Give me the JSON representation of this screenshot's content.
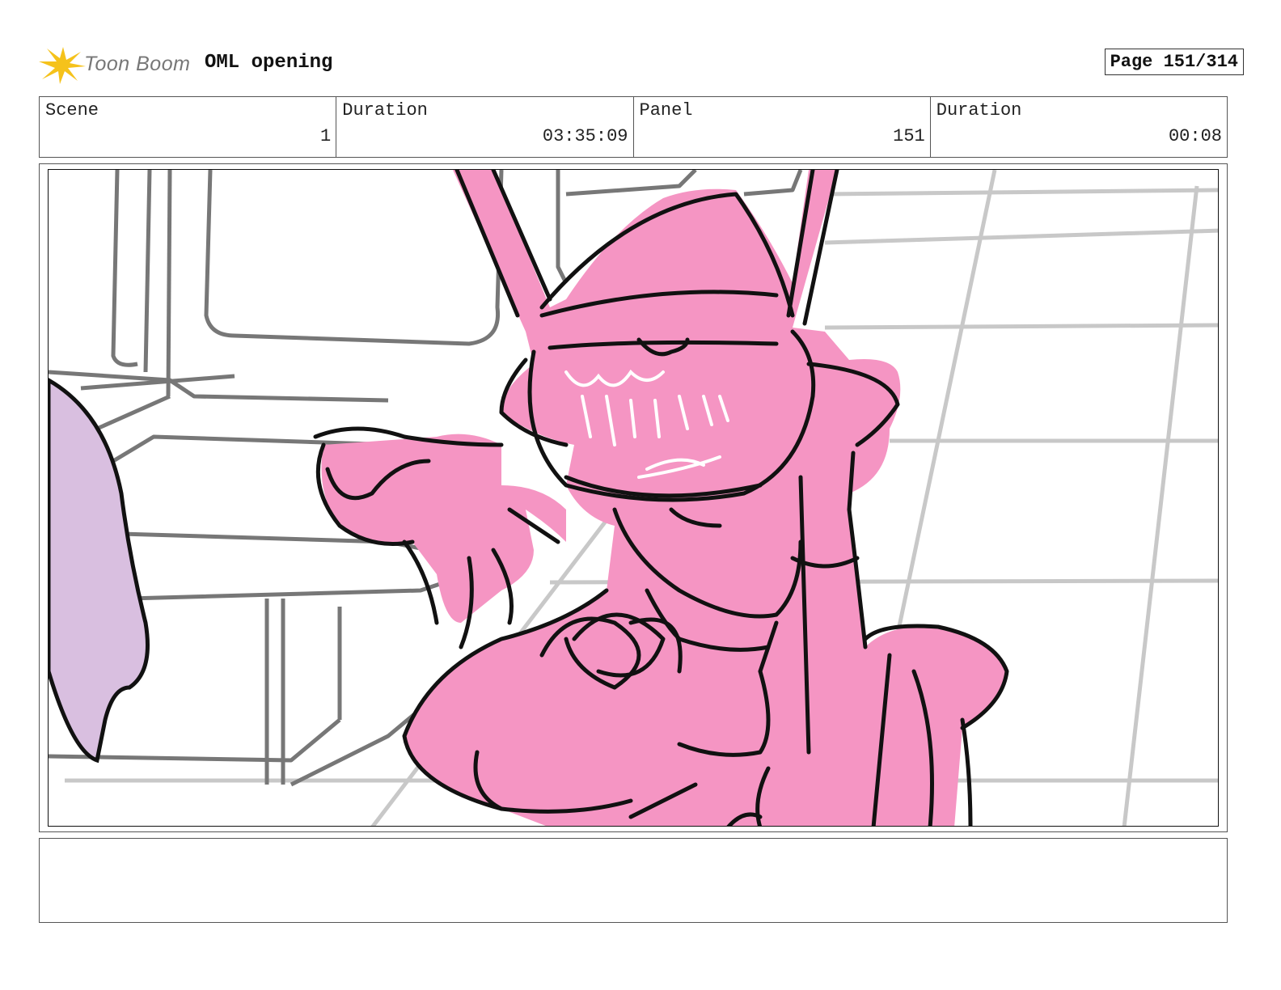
{
  "header": {
    "brand": "Toon Boom",
    "project_title": "OML opening",
    "page_label": "Page 151/314"
  },
  "info": {
    "scene_label": "Scene",
    "scene_value": "1",
    "duration_label": "Duration",
    "duration_value": "03:35:09",
    "panel_label": "Panel",
    "panel_value": "151",
    "panel_duration_label": "Duration",
    "panel_duration_value": "00:08"
  },
  "colors": {
    "character_fill": "#f595c3",
    "side_character_fill": "#d9bfe0",
    "background_line": "#777777",
    "floor_grid": "#c8c8c8",
    "logo_star": "#f5c21b"
  },
  "notes": ""
}
